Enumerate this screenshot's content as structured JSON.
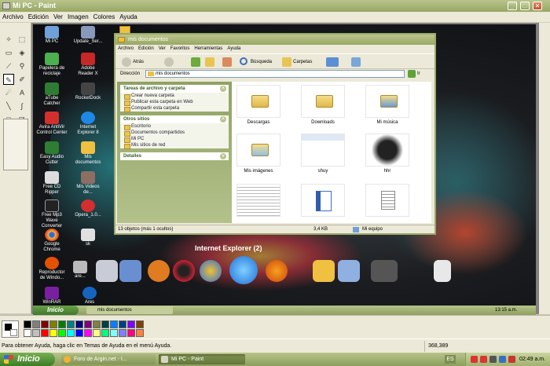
{
  "window": {
    "title": "Mi PC - Paint",
    "btn_min": "_",
    "btn_max": "□",
    "btn_close": "×"
  },
  "menu": [
    "Archivo",
    "Edición",
    "Ver",
    "Imagen",
    "Colores",
    "Ayuda"
  ],
  "tools": [
    "free-select",
    "rect-select",
    "eraser",
    "fill",
    "picker",
    "magnifier",
    "pencil",
    "brush",
    "airbrush",
    "text",
    "line",
    "curve",
    "rectangle",
    "polygon",
    "ellipse",
    "rounded-rect"
  ],
  "desktop": {
    "icons": [
      {
        "label": "Mi PC",
        "color": "#6fa0d8"
      },
      {
        "label": "Papelera de reciclaje",
        "color": "#4caf50"
      },
      {
        "label": "aTube Catcher",
        "color": "#2e7d32"
      },
      {
        "label": "Avira AntiVir Control Center",
        "color": "#d32f2f"
      },
      {
        "label": "Easy Audio Cutter",
        "color": "#2e7d32"
      },
      {
        "label": "Free CD Ripper",
        "color": "#ddd"
      },
      {
        "label": "Free Mp3 Wave Converter",
        "color": "#222"
      },
      {
        "label": "Google Chrome",
        "color": "#f2c230"
      },
      {
        "label": "Reproductor de Windo...",
        "color": "#e65100"
      },
      {
        "label": "WinRAR",
        "color": "#7b1fa2"
      },
      {
        "label": "Update_Ser...",
        "color": "#8899bb"
      },
      {
        "label": "Adobe Reader X",
        "color": "#c62828"
      },
      {
        "label": "RocketDock",
        "color": "#444"
      },
      {
        "label": "Internet Explorer 8",
        "color": "#1e88e5"
      },
      {
        "label": "Mis documentos",
        "color": "#f0c040"
      },
      {
        "label": "Mis Videos de...",
        "color": "#8d6e63"
      },
      {
        "label": "Opera_1.0...",
        "color": "#d32f2f"
      },
      {
        "label": "sk",
        "color": "#e0e0e0"
      },
      {
        "label": "are...",
        "color": "#bbb"
      },
      {
        "label": "Ares",
        "color": "#1565c0"
      }
    ],
    "dock_label": "Internet Explorer (2)"
  },
  "explorer": {
    "title": "mis documentos",
    "menu": [
      "Archivo",
      "Edición",
      "Ver",
      "Favoritos",
      "Herramientas",
      "Ayuda"
    ],
    "toolbar": {
      "back": "Atrás",
      "search": "Búsqueda",
      "folders": "Carpetas"
    },
    "address_label": "Dirección",
    "address": "mis documentos",
    "go": "Ir",
    "panes": [
      {
        "title": "Tareas de archivo y carpeta",
        "items": [
          "Crear nueva carpeta",
          "Publicar esta carpeta en Web",
          "Compartir esta carpeta"
        ]
      },
      {
        "title": "Otros sitios",
        "items": [
          "Escritorio",
          "Documentos compartidos",
          "Mi PC",
          "Mis sitios de red"
        ]
      },
      {
        "title": "Detalles",
        "items": []
      }
    ],
    "files": [
      {
        "name": "Descargas",
        "kind": "folder"
      },
      {
        "name": "Downloads",
        "kind": "folder"
      },
      {
        "name": "Mi música",
        "kind": "folder"
      },
      {
        "name": "Mis imágenes",
        "kind": "folder"
      },
      {
        "name": "shuy",
        "kind": "image"
      },
      {
        "name": "hhr",
        "kind": "image"
      },
      {
        "name": "",
        "kind": "doc"
      },
      {
        "name": "",
        "kind": "doc"
      },
      {
        "name": "",
        "kind": "doc"
      }
    ],
    "status": {
      "count": "13 objetos (más 1 ocultos)",
      "size": "3,4 KB",
      "location": "Mi equipo"
    }
  },
  "inner_taskbar": {
    "start": "Inicio",
    "window": "mis documentos",
    "clock": "13:15 a.m."
  },
  "palette_colors": [
    "#000000",
    "#808080",
    "#800000",
    "#808000",
    "#008000",
    "#008080",
    "#000080",
    "#800080",
    "#808040",
    "#004040",
    "#0080ff",
    "#004080",
    "#8000ff",
    "#804000",
    "#ffffff",
    "#c0c0c0",
    "#ff0000",
    "#ffff00",
    "#00ff00",
    "#00ffff",
    "#0000ff",
    "#ff00ff",
    "#ffff80",
    "#00ff80",
    "#80ffff",
    "#8080ff",
    "#ff0080",
    "#ff8040"
  ],
  "help_text": "Para obtener Ayuda, haga clic en Temas de Ayuda en el menú Ayuda.",
  "coords": "368,389",
  "taskbar": {
    "start": "Inicio",
    "buttons": [
      {
        "label": "Foro de Argin.net - I...",
        "color": "#f2b233"
      },
      {
        "label": "Mi PC - Paint",
        "color": "#d8d4c4"
      }
    ],
    "lang": "ES",
    "clock": "02:49 a.m."
  }
}
